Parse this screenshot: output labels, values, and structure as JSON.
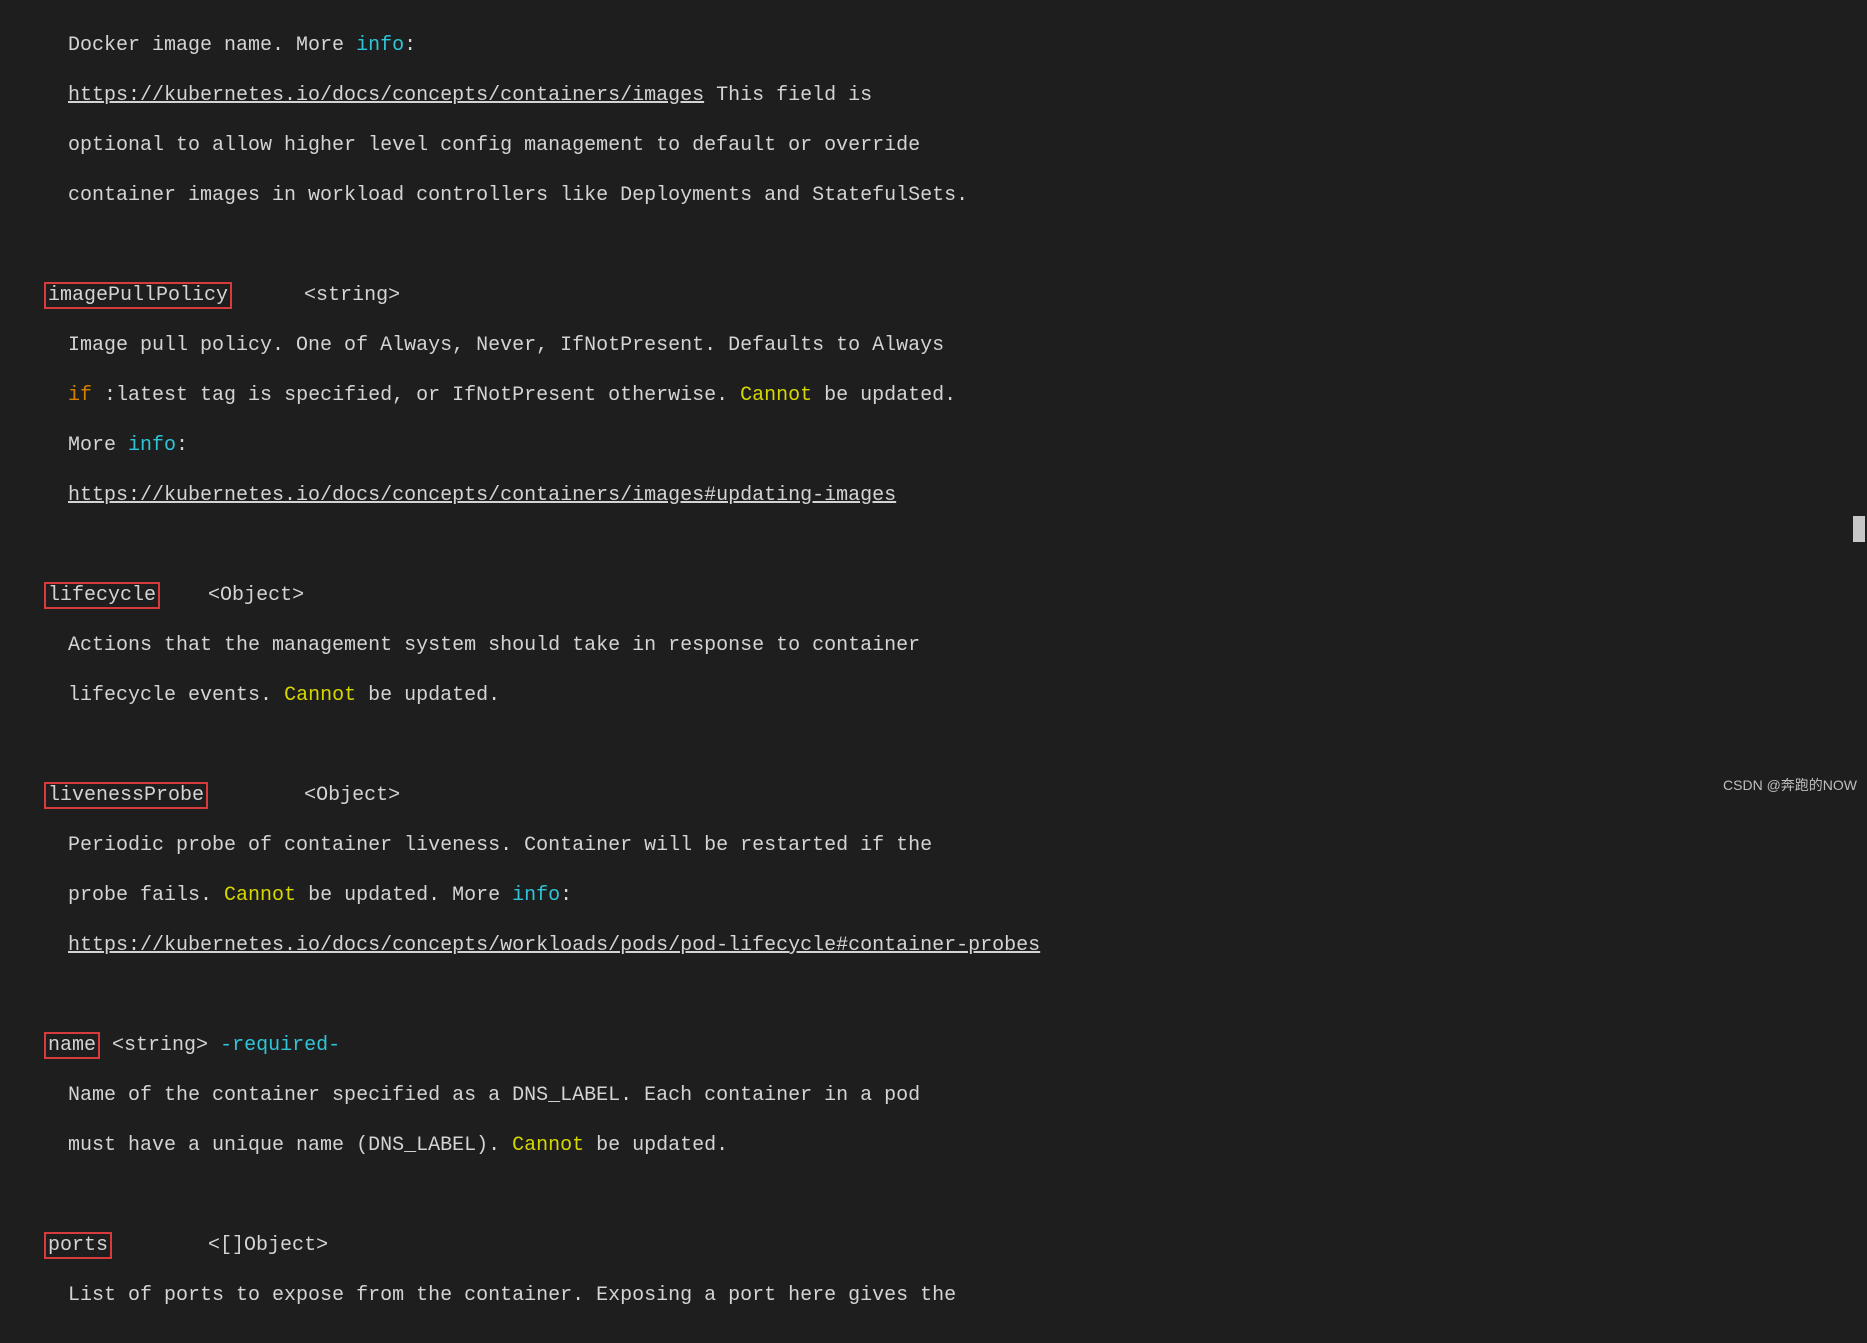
{
  "leadIndent": "     ",
  "descIndent": "   ",
  "nameIndent": "",
  "fields": {
    "image": {
      "desc1": "Docker image name. More ",
      "info": "info",
      "colon": ":",
      "link": "https://kubernetes.io/docs/concepts/containers/images",
      "desc2": " This field is",
      "desc3": "optional to allow higher level config management to default or override",
      "desc4": "container images in workload controllers like Deployments and StatefulSets."
    },
    "imagePullPolicy": {
      "name": "imagePullPolicy",
      "type": "      <string>",
      "desc1": "Image pull policy. One of Always, Never, IfNotPresent. Defaults to Always",
      "ifKw": "if",
      "desc2a": " :latest tag is specified, or IfNotPresent otherwise. ",
      "cannot": "Cannot",
      "desc2b": " be updated.",
      "more": "More ",
      "info": "info",
      "colon": ":",
      "link": "https://kubernetes.io/docs/concepts/containers/images#updating-images"
    },
    "lifecycle": {
      "name": "lifecycle",
      "type": "    <Object>",
      "desc1": "Actions that the management system should take in response to container",
      "desc2a": "lifecycle events. ",
      "cannot": "Cannot",
      "desc2b": " be updated."
    },
    "livenessProbe": {
      "name": "livenessProbe",
      "type": "        <Object>",
      "desc1": "Periodic probe of container liveness. Container will be restarted if the",
      "desc2a": "probe fails. ",
      "cannot": "Cannot",
      "desc2b": " be updated. More ",
      "info": "info",
      "colon": ":",
      "link": "https://kubernetes.io/docs/concepts/workloads/pods/pod-lifecycle#container-probes"
    },
    "name": {
      "name": "name",
      "type": " <string> ",
      "required": "-required-",
      "desc1": "Name of the container specified as a DNS_LABEL. Each container in a pod",
      "desc2a": "must have a unique name (DNS_LABEL). ",
      "cannot": "Cannot",
      "desc2b": " be updated."
    },
    "ports": {
      "name": "ports",
      "type": "        <[]Object>",
      "desc1": "List of ports to expose from the container. Exposing a port here gives the"
    }
  },
  "watermark": "CSDN @奔跑的NOW"
}
